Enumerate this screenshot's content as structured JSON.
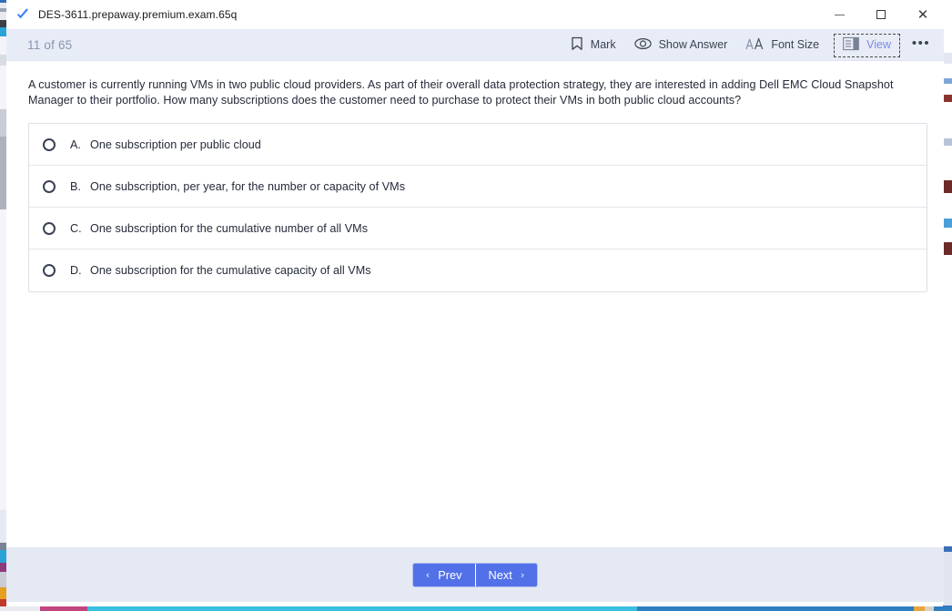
{
  "window": {
    "title": "DES-3611.prepaway.premium.exam.65q",
    "app_icon": "blue-check-icon",
    "controls": {
      "minimize": "–",
      "maximize": "□",
      "close": "✕"
    }
  },
  "toolbar": {
    "progress": "11 of 65",
    "mark_label": "Mark",
    "show_answer_label": "Show Answer",
    "font_size_label": "Font Size",
    "view_label": "View",
    "more_label": "•••"
  },
  "question": {
    "text": "A customer is currently running VMs in two public cloud providers. As part of their overall data protection strategy, they are interested in adding Dell EMC Cloud Snapshot Manager to their portfolio. How many subscriptions does the customer need to purchase to protect their VMs in both public cloud accounts?",
    "options": [
      {
        "letter": "A.",
        "text": "One subscription per public cloud",
        "selected": false
      },
      {
        "letter": "B.",
        "text": "One subscription, per year, for the number or capacity of VMs",
        "selected": false
      },
      {
        "letter": "C.",
        "text": "One subscription for the cumulative number of all VMs",
        "selected": false
      },
      {
        "letter": "D.",
        "text": "One subscription for the cumulative capacity of all VMs",
        "selected": false
      }
    ]
  },
  "footer": {
    "prev_label": "Prev",
    "next_label": "Next",
    "prev_chevron": "‹",
    "next_chevron": "›"
  },
  "colors": {
    "toolbar_bg": "#e8ecf6",
    "footer_bg": "#e4e9f3",
    "accent_button": "#5271e8",
    "view_active_text": "#7b8be0",
    "progress_text": "#8a96b0",
    "body_text": "#242a38"
  }
}
